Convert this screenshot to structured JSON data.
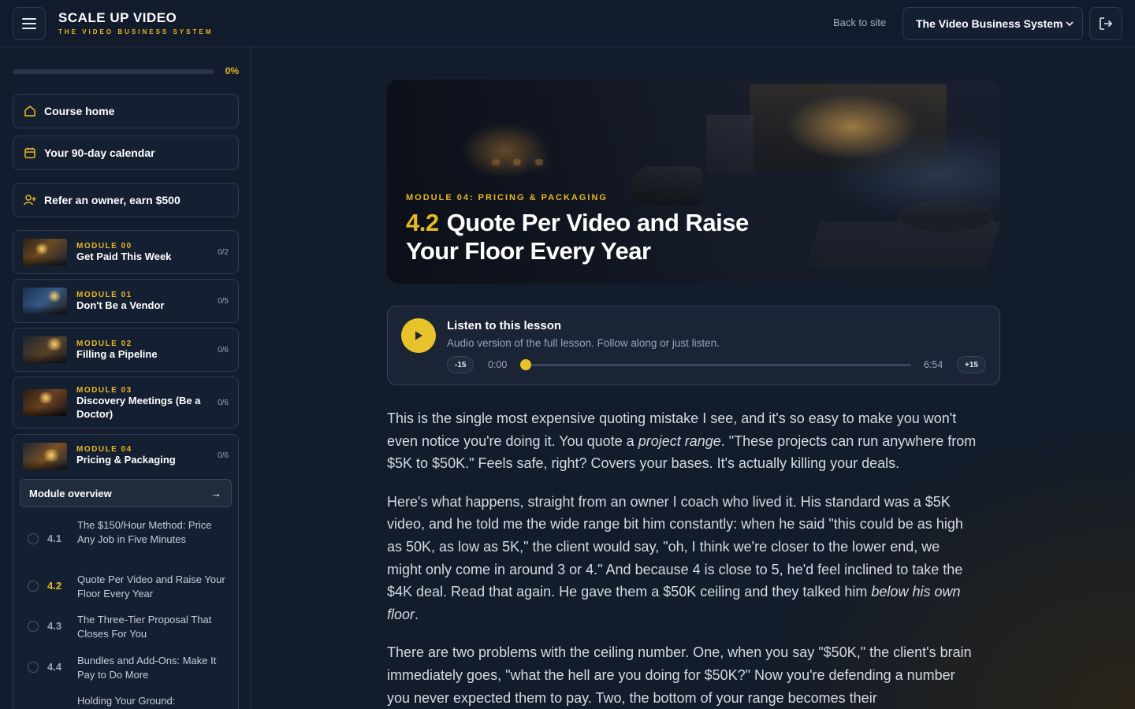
{
  "header": {
    "brand_title": "SCALE UP VIDEO",
    "brand_subtitle": "THE VIDEO BUSINESS SYSTEM",
    "back_link": "Back to site",
    "course_selected": "The Video Business System",
    "icons": {
      "menu": "hamburger-icon",
      "dropdown": "chevron-down-icon",
      "logout": "logout-icon"
    }
  },
  "sidebar": {
    "progress_pct_label": "0%",
    "progress_value": 0,
    "nav": [
      {
        "label": "Course home",
        "icon": "home-icon"
      },
      {
        "label": "Your 90-day calendar",
        "icon": "calendar-icon"
      },
      {
        "label": "Refer an owner, earn $500",
        "icon": "user-plus-icon"
      }
    ],
    "modules": [
      {
        "label": "MODULE 00",
        "title": "Get Paid This Week",
        "count": "0/2"
      },
      {
        "label": "MODULE 01",
        "title": "Don't Be a Vendor",
        "count": "0/5"
      },
      {
        "label": "MODULE 02",
        "title": "Filling a Pipeline",
        "count": "0/6"
      },
      {
        "label": "MODULE 03",
        "title": "Discovery Meetings (Be a Doctor)",
        "count": "0/6"
      },
      {
        "label": "MODULE 04",
        "title": "Pricing & Packaging",
        "count": "0/6"
      }
    ],
    "overview_label": "Module overview",
    "overview_arrow": "→",
    "lessons": [
      {
        "num": "4.1",
        "title": "The $150/Hour Method: Price Any Job in Five Minutes"
      },
      {
        "num": "4.2",
        "title": "Quote Per Video and Raise Your Floor Every Year"
      },
      {
        "num": "4.3",
        "title": "The Three-Tier Proposal That Closes For You"
      },
      {
        "num": "4.4",
        "title": "Bundles and Add-Ons: Make It Pay to Do More"
      },
      {
        "num": "",
        "title": "Holding Your Ground:"
      }
    ]
  },
  "hero": {
    "module_label": "MODULE 04: PRICING & PACKAGING",
    "lesson_num": "4.2",
    "lesson_title": "Quote Per Video and Raise Your Floor Every Year"
  },
  "audio": {
    "title": "Listen to this lesson",
    "subtitle": "Audio version of the full lesson. Follow along or just listen.",
    "skip_back": "-15",
    "skip_forward": "+15",
    "current_time": "0:00",
    "total_time": "6:54",
    "progress": 0
  },
  "article": {
    "p1": [
      "This is the single most expensive quoting mistake I see, and it's so easy to make you won't even notice you're doing it. You quote a ",
      "project range",
      ". \"These projects can run anywhere from $5K to $50K.\" Feels safe, right? Covers your bases. It's actually killing your deals."
    ],
    "p2": [
      "Here's what happens, straight from an owner I coach who lived it. His standard was a $5K video, and he told me the wide range bit him constantly: when he said \"this could be as high as 50K, as low as 5K,\" the client would say, \"oh, I think we're closer to the lower end, we might only come in around 3 or 4.\" And because 4 is close to 5, he'd feel inclined to take the $4K deal. Read that again. He gave them a $50K ceiling and they talked him ",
      "below his own floor",
      "."
    ],
    "p3": "There are two problems with the ceiling number. One, when you say \"$50K,\" the client's brain immediately goes, \"what the hell are you doing for $50K?\" Now you're defending a number you never expected them to pay. Two, the bottom of your range becomes their"
  },
  "colors": {
    "accent": "#e8b923",
    "background": "#131c2a",
    "panel": "#141f31"
  }
}
